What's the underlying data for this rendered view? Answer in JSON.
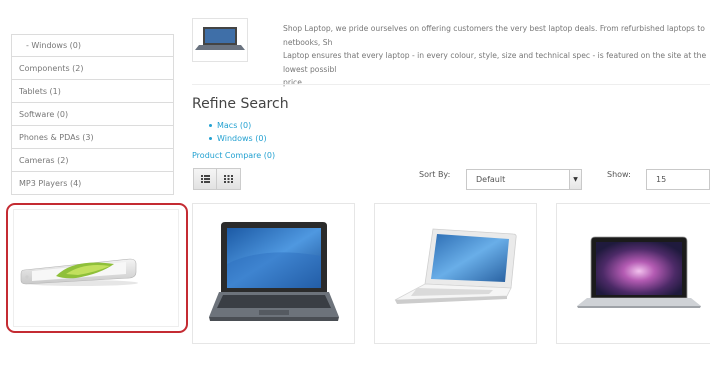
{
  "sidebar": {
    "categories": [
      {
        "label": "- Windows (0)"
      },
      {
        "label": "Components (2)"
      },
      {
        "label": "Tablets (1)"
      },
      {
        "label": "Software (0)"
      },
      {
        "label": "Phones & PDAs (3)"
      },
      {
        "label": "Cameras (2)"
      },
      {
        "label": "MP3 Players (4)"
      }
    ]
  },
  "category": {
    "description_line1": "Shop Laptop, we pride ourselves on offering customers the very best laptop deals. From refurbished laptops to netbooks, Sh",
    "description_line2": "Laptop ensures that every laptop - in every colour, style, size and technical spec - is featured on the site at the lowest possibl",
    "description_line3": "price."
  },
  "refine": {
    "title": "Refine Search",
    "links": [
      "Macs (0)",
      "Windows (0)"
    ]
  },
  "toolbar": {
    "product_compare": "Product Compare (0)",
    "sort_label": "Sort By:",
    "sort_value": "Default",
    "show_label": "Show:",
    "show_value": "15"
  },
  "colors": {
    "link": "#23a1d1",
    "highlight_border": "#c42b32"
  },
  "icons": {
    "list_view": "list-view-icon",
    "grid_view": "grid-view-icon",
    "caret": "caret-down-icon"
  }
}
